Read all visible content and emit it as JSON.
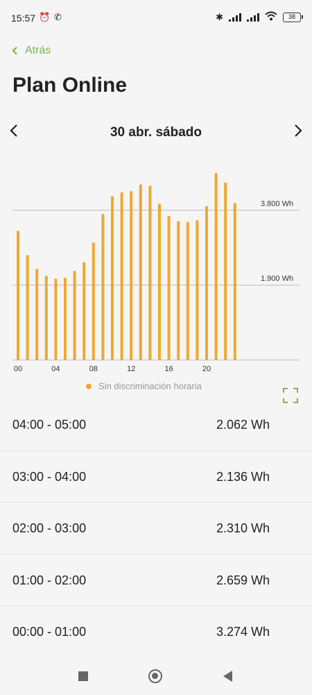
{
  "status_bar": {
    "time": "15:57",
    "battery": "38",
    "icons": [
      "alarm-icon",
      "whatsapp-icon",
      "bluetooth-icon",
      "signal-icon",
      "signal-icon",
      "wifi-icon",
      "battery-icon"
    ]
  },
  "header": {
    "back_label": "Atrás",
    "title": "Plan Online"
  },
  "date_nav": {
    "date": "30 abr. sábado"
  },
  "colors": {
    "accent": "#7ab648",
    "bar": "#f0a830"
  },
  "chart_data": {
    "type": "bar",
    "categories": [
      "00",
      "01",
      "02",
      "03",
      "04",
      "05",
      "06",
      "07",
      "08",
      "09",
      "10",
      "11",
      "12",
      "13",
      "14",
      "15",
      "16",
      "17",
      "18",
      "19",
      "20",
      "21",
      "22",
      "23"
    ],
    "tick_labels": [
      "00",
      "04",
      "08",
      "12",
      "16",
      "20"
    ],
    "values": [
      3274,
      2659,
      2310,
      2136,
      2062,
      2080,
      2260,
      2480,
      2980,
      3700,
      4150,
      4250,
      4280,
      4450,
      4420,
      3960,
      3650,
      3520,
      3500,
      3540,
      3900,
      4740,
      4500,
      3980
    ],
    "reference_lines": [
      {
        "value": 3800,
        "label": "3.800 Wh"
      },
      {
        "value": 1900,
        "label": "1.900 Wh"
      }
    ],
    "ylim": [
      0,
      4900
    ],
    "legend": "Sin discriminación horaria",
    "grid": true
  },
  "list": {
    "rows": [
      {
        "range": "04:00 - 05:00",
        "value": "2.062 Wh"
      },
      {
        "range": "03:00 - 04:00",
        "value": "2.136 Wh"
      },
      {
        "range": "02:00 - 03:00",
        "value": "2.310 Wh"
      },
      {
        "range": "01:00 - 02:00",
        "value": "2.659 Wh"
      },
      {
        "range": "00:00 - 01:00",
        "value": "3.274 Wh"
      }
    ]
  }
}
